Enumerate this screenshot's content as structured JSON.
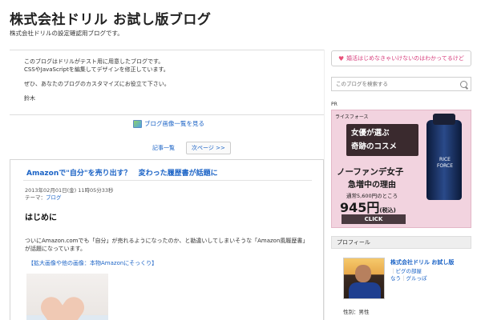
{
  "header": {
    "site_title": "株式会社ドリル お試し版ブログ",
    "site_desc": "株式会社ドリルの設定確認用ブログです。"
  },
  "intro": {
    "line1": "このブログはドリルがテスト用に用意したブログです。",
    "line2": "CSSやJavaScriptを編集してデザインを修正しています。",
    "line3": "ぜひ、あなたのブログのカスタマイズにお役立て下さい。",
    "line4": "鈴木"
  },
  "image_list_link": "ブログ画像一覧を見る",
  "pager": {
    "list_label": "記事一覧",
    "next_label": "次ページ >>"
  },
  "article": {
    "title": "Amazonで\"自分\"を売り出す？　変わった履歴書が話題に",
    "date": "2013年02月01日(金) 11時05分33秒",
    "theme_prefix": "テーマ：",
    "theme_link": "ブログ",
    "heading": "はじめに",
    "body_line1": "ついにAmazon.comでも「自分」が売れるようになったのか、と勘違いしてしまいそうな「Amazon風履歴書」",
    "body_line2": "が話題になっています。",
    "enlarge_link": "【拡大画像や他の画像：本物Amazonにそっくり】"
  },
  "sidebar": {
    "notice": "婚活はじめなきゃいけないのはわかってるけど",
    "search_placeholder": "このブログを検索する",
    "pr_label": "PR",
    "ad": {
      "brand": "ライスフォース",
      "catch1": "女優が選ぶ",
      "catch2": "奇跡のコスメ",
      "bottle_text": "RICE FORCE",
      "headline1": "ノーファンデ女子",
      "headline2": "急増中の理由",
      "sub": "通常5,600円のところ",
      "price": "945円",
      "price_tax": "(税込)",
      "click": "CLICK"
    },
    "profile": {
      "heading": "プロフィール",
      "name": "株式会社ドリル お試し版",
      "link1": "ピグの部屋",
      "link2": "なう",
      "link3": "グルっぽ",
      "gender": "性別：男性"
    }
  }
}
